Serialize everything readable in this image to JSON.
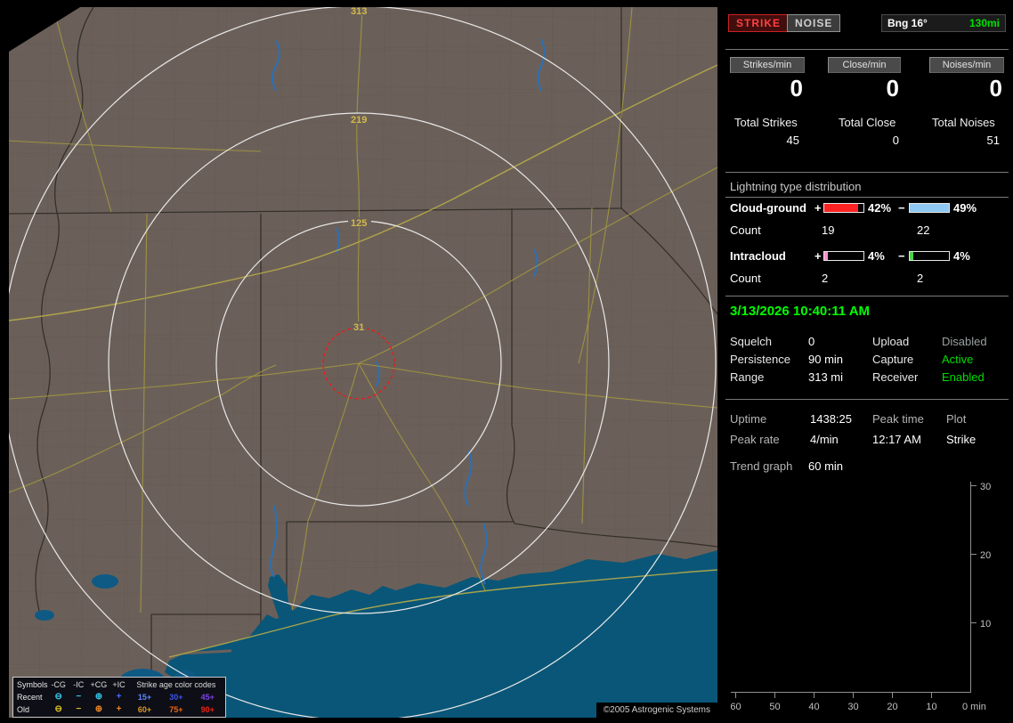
{
  "colors": {
    "active_green": "#00dd00",
    "datetime_green": "#00ff00",
    "strike_red": "#ff4040",
    "range_green": "#00e000"
  },
  "map": {
    "ring_labels": [
      "313",
      "219",
      "125",
      "31"
    ],
    "legend": {
      "header_symbols": "Symbols",
      "header_types": [
        "-CG",
        "-IC",
        "+CG",
        "+IC"
      ],
      "header_ages": "Strike age color codes",
      "rows": [
        {
          "name": "Recent",
          "glyphs": [
            "⊖",
            "−",
            "⊕",
            "+"
          ],
          "glyph_colors": [
            "#38c8ec",
            "#38c8ec",
            "#38c8ec",
            "#4868ff"
          ],
          "ages": [
            "15+",
            "30+",
            "45+"
          ],
          "age_colors": [
            "#5b86ff",
            "#3a55f0",
            "#7a46e8"
          ]
        },
        {
          "name": "Old",
          "glyphs": [
            "⊖",
            "−",
            "⊕",
            "+"
          ],
          "glyph_colors": [
            "#ddc422",
            "#ddc422",
            "#ee8822",
            "#ee8822"
          ],
          "ages": [
            "60+",
            "75+",
            "90+"
          ],
          "age_colors": [
            "#dd9922",
            "#ee6611",
            "#ee2211"
          ]
        }
      ]
    },
    "copyright": "©2005 Astrogenic Systems"
  },
  "panel": {
    "strike_button": "STRIKE",
    "noise_button": "NOISE",
    "bearing": "Bng 16°",
    "range": "130mi",
    "counters": [
      {
        "label": "Strikes/min",
        "value": "0",
        "total_label": "Total Strikes",
        "total_value": "45"
      },
      {
        "label": "Close/min",
        "value": "0",
        "total_label": "Total Close",
        "total_value": "0"
      },
      {
        "label": "Noises/min",
        "value": "0",
        "total_label": "Total Noises",
        "total_value": "51"
      }
    ],
    "distribution": {
      "title": "Lightning type distribution",
      "plus_sign": "+",
      "minus_sign": "−",
      "rows": [
        {
          "label": "Cloud-ground",
          "plus_pct": "42%",
          "minus_pct": "49%",
          "plus_fill": 86,
          "minus_fill": 100,
          "plus_color": "#ff2222",
          "minus_color": "#8fc8f2",
          "count_label": "Count",
          "plus_count": "19",
          "minus_count": "22"
        },
        {
          "label": "Intracloud",
          "plus_pct": "4%",
          "minus_pct": "4%",
          "plus_fill": 9,
          "minus_fill": 9,
          "plus_color": "#f493cf",
          "minus_color": "#4ed04e",
          "count_label": "Count",
          "plus_count": "2",
          "minus_count": "2"
        }
      ]
    },
    "datetime": "3/13/2026 10:40:11 AM",
    "status_rows": [
      {
        "key1": "Squelch",
        "val1": "0",
        "key2": "Upload",
        "val2": "Disabled",
        "val2_state": "disabled"
      },
      {
        "key1": "Persistence",
        "val1": "90 min",
        "key2": "Capture",
        "val2": "Active",
        "val2_state": "active"
      },
      {
        "key1": "Range",
        "val1": "313 mi",
        "key2": "Receiver",
        "val2": "Enabled",
        "val2_state": "active"
      }
    ],
    "stats": {
      "uptime_label": "Uptime",
      "uptime_value": "1438:25",
      "peak_time_label": "Peak time",
      "plot_label": "Plot",
      "peak_rate_label": "Peak rate",
      "peak_rate_value": "4/min",
      "peak_time_value": "12:17 AM",
      "plot_value": "Strike",
      "trend_label": "Trend graph",
      "trend_value": "60 min"
    },
    "graph": {
      "y_ticks": [
        "30",
        "20",
        "10"
      ],
      "x_ticks": [
        "60",
        "50",
        "40",
        "30",
        "20",
        "10"
      ],
      "origin_label": "0 min"
    }
  }
}
